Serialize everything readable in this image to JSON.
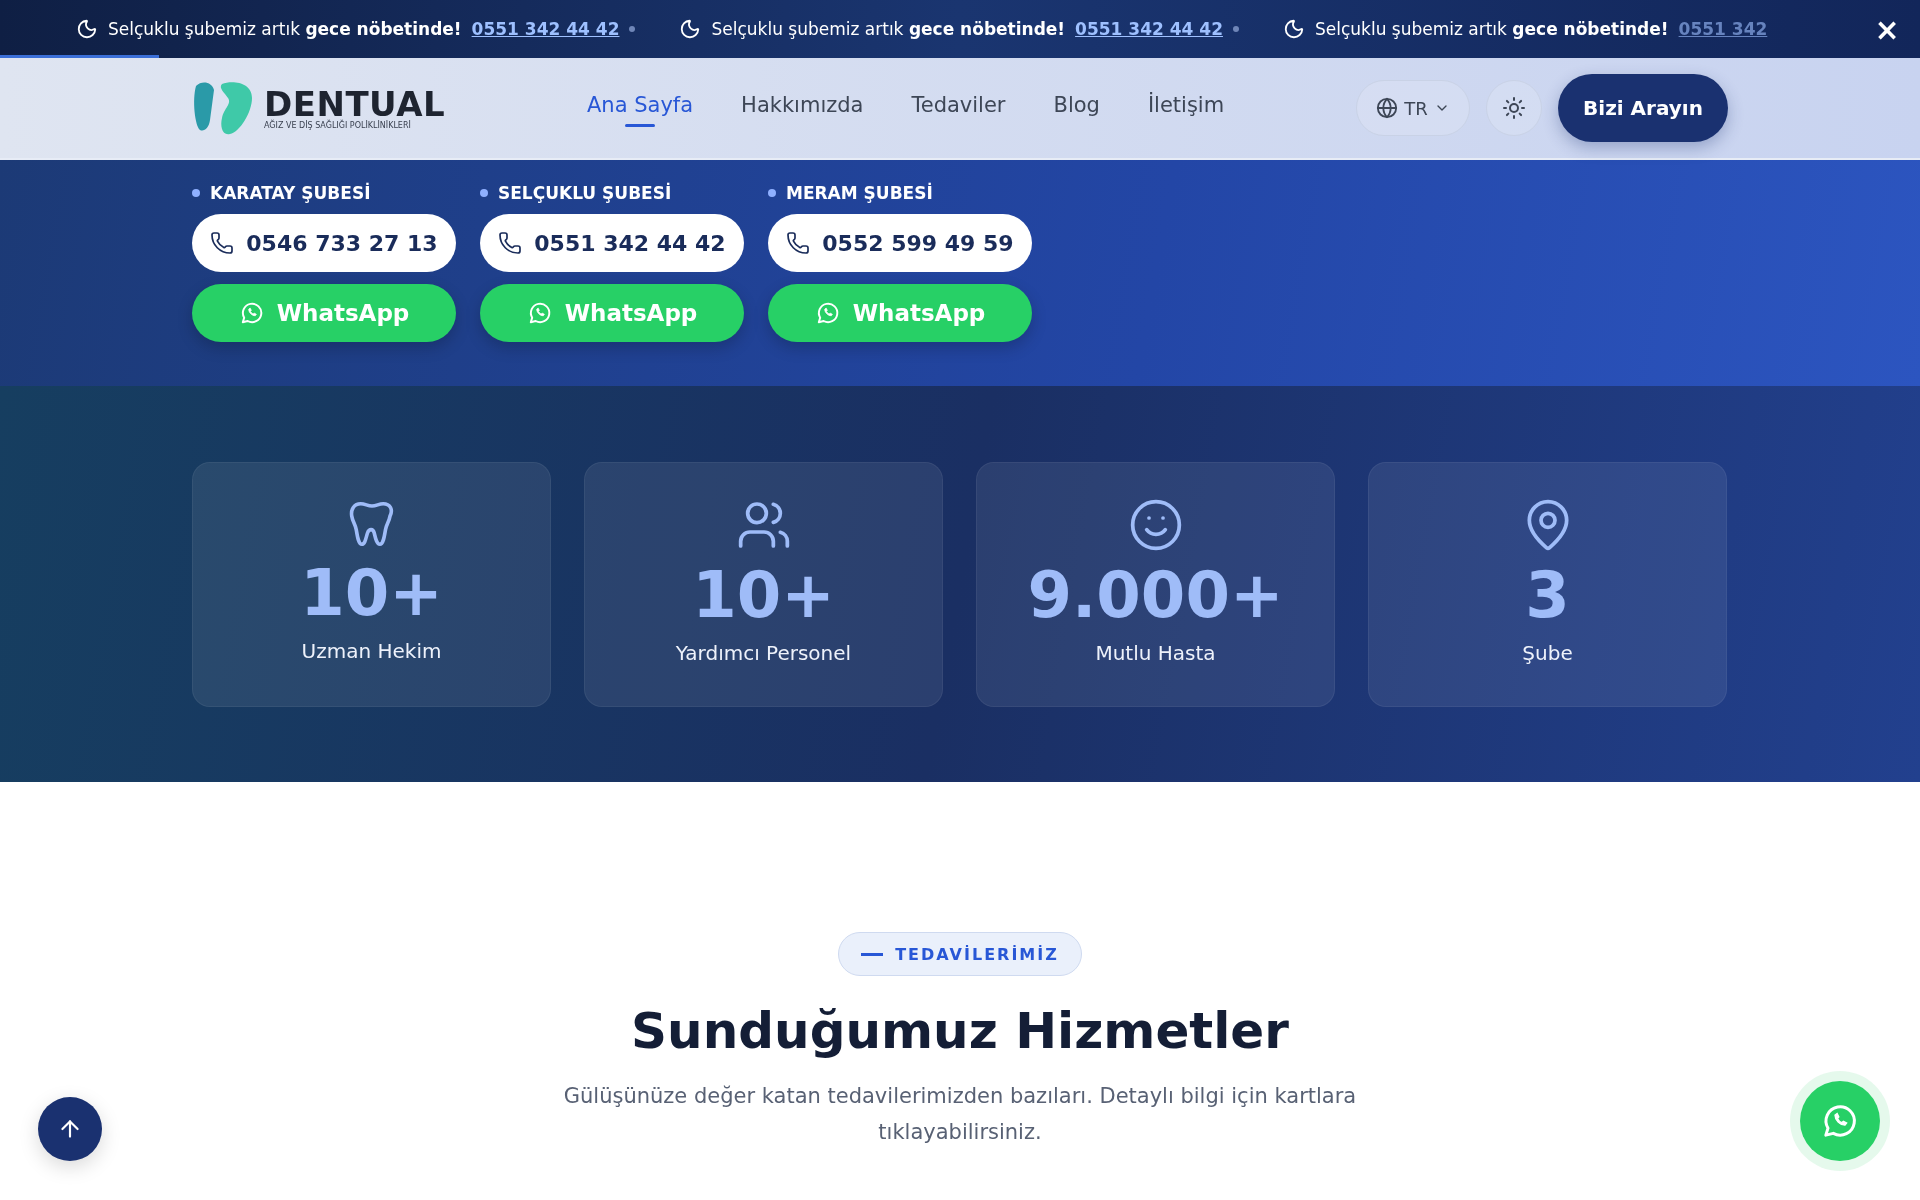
{
  "ticker": {
    "items": [
      {
        "text": "Selçuklu şubemiz artık **gece nöbetinde!**",
        "phone": "0551 342 44 42"
      },
      {
        "text": "Selçuklu şubemiz artık **gece nöbetinde!**",
        "phone": "0551 342 44 42"
      },
      {
        "text": "Selçuklu şubemiz artık **gece nöbetinde!**",
        "phone": "0551 342"
      }
    ],
    "close": "×",
    "progress": {
      "level": 0.083
    }
  },
  "header": {
    "logo": {
      "name": "DENTUAL",
      "tagline": "AĞIZ VE DİŞ SAĞLIĞI POLİKLİNİKLERİ"
    },
    "nav": [
      {
        "label": "Ana Sayfa",
        "selected": true
      },
      {
        "label": "Hakkımızda",
        "selected": false
      },
      {
        "label": "Tedaviler",
        "selected": false
      },
      {
        "label": "Blog",
        "selected": false
      },
      {
        "label": "İletişim",
        "selected": false
      }
    ],
    "language": "TR",
    "cta": "Bizi Arayın"
  },
  "branches": [
    {
      "name": "KARATAY ŞUBESİ",
      "phone": "0546 733 27 13",
      "whatsapp": "WhatsApp"
    },
    {
      "name": "SELÇUKLU ŞUBESİ",
      "phone": "0551 342 44 42",
      "whatsapp": "WhatsApp"
    },
    {
      "name": "MERAM ŞUBESİ",
      "phone": "0552 599 49 59",
      "whatsapp": "WhatsApp"
    }
  ],
  "stats": [
    {
      "kind": "tooth",
      "value": "10+",
      "label": "Uzman Hekim"
    },
    {
      "kind": "people",
      "value": "10+",
      "label": "Yardımcı Personel"
    },
    {
      "kind": "smile",
      "value": "9.000+",
      "label": "Mutlu Hasta"
    },
    {
      "kind": "pin",
      "value": "3",
      "label": "Şube"
    }
  ],
  "services": {
    "badge": "TEDAVİLERİMİZ",
    "title": "Sunduğumuz Hizmetler",
    "description": "Gülüşünüze değer katan tedavilerimizden bazıları. Detaylı bilgi için kartlara tıklayabilirsiniz."
  }
}
